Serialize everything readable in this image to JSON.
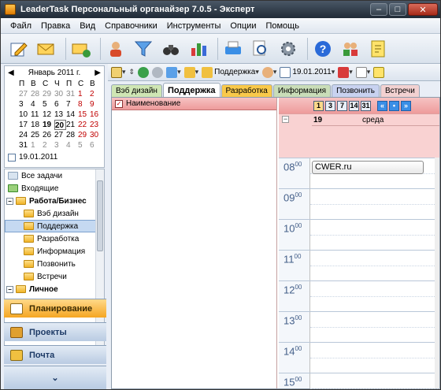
{
  "window": {
    "title": "LeaderTask Персональный органайзер 7.0.5 - Эксперт"
  },
  "menu": [
    "Файл",
    "Правка",
    "Вид",
    "Справочники",
    "Инструменты",
    "Опции",
    "Помощь"
  ],
  "toolbar": {
    "icons": [
      "edit-task-icon",
      "new-mail-icon",
      "send-mail-icon",
      "contacts-icon",
      "filter-icon",
      "binoculars-icon",
      "chart-icon",
      "print-icon",
      "search-doc-icon",
      "settings-icon",
      "help-icon",
      "users-icon",
      "notes-icon"
    ]
  },
  "calendar": {
    "month_label": "Январь 2011 г.",
    "weekdays": [
      "П",
      "В",
      "С",
      "Ч",
      "П",
      "С",
      "В"
    ],
    "weeks": [
      [
        "27",
        "28",
        "29",
        "30",
        "31",
        "1",
        "2"
      ],
      [
        "3",
        "4",
        "5",
        "6",
        "7",
        "8",
        "9"
      ],
      [
        "10",
        "11",
        "12",
        "13",
        "14",
        "15",
        "16"
      ],
      [
        "17",
        "18",
        "19",
        "20",
        "21",
        "22",
        "23"
      ],
      [
        "24",
        "25",
        "26",
        "27",
        "28",
        "29",
        "30"
      ],
      [
        "31",
        "1",
        "2",
        "3",
        "4",
        "5",
        "6"
      ]
    ],
    "today_label": "19.01.2011"
  },
  "tree": {
    "items": [
      {
        "label": "Все задачи",
        "indent": 0
      },
      {
        "label": "Входящие",
        "indent": 0
      },
      {
        "label": "Работа/Бизнес",
        "indent": 0
      },
      {
        "label": "Вэб дизайн",
        "indent": 1
      },
      {
        "label": "Поддержка",
        "indent": 1
      },
      {
        "label": "Разработка",
        "indent": 1
      },
      {
        "label": "Информация",
        "indent": 1
      },
      {
        "label": "Позвонить",
        "indent": 1
      },
      {
        "label": "Встречи",
        "indent": 1
      },
      {
        "label": "Личное",
        "indent": 0
      }
    ]
  },
  "nav": {
    "planning": "Планирование",
    "projects": "Проекты",
    "mail": "Почта"
  },
  "viewbar": {
    "project_label": "Поддержка",
    "date_label": "19.01.2011"
  },
  "tabs": [
    {
      "label": "Вэб дизайн",
      "color": "#cfe6b4"
    },
    {
      "label": "Поддержка",
      "color": "#ffffff"
    },
    {
      "label": "Разработка",
      "color": "#f9c94a"
    },
    {
      "label": "Информация",
      "color": "#c9ddb8"
    },
    {
      "label": "Позвонить",
      "color": "#c8d2f0"
    },
    {
      "label": "Встречи",
      "color": "#f2d1d1"
    }
  ],
  "list": {
    "column_header": "Наименование"
  },
  "day": {
    "view_buttons": [
      "1",
      "3",
      "7",
      "14",
      "31"
    ],
    "day_number": "19",
    "day_name": "среда",
    "hours": [
      "08",
      "09",
      "10",
      "11",
      "12",
      "13",
      "14",
      "15"
    ],
    "event": "CWER.ru"
  }
}
